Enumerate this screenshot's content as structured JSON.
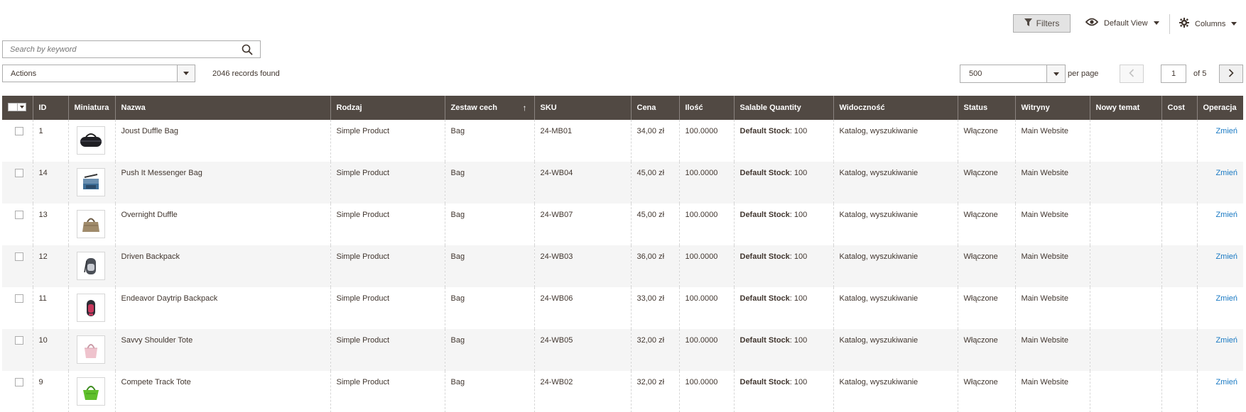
{
  "toolbar": {
    "filters_label": "Filters",
    "view_label": "Default View",
    "columns_label": "Columns"
  },
  "search": {
    "placeholder": "Search by keyword"
  },
  "actions": {
    "label": "Actions"
  },
  "records": {
    "label": "2046 records found"
  },
  "pager": {
    "per_page_value": "500",
    "per_page_label": "per page",
    "current_page": "1",
    "of_label": "of 5"
  },
  "table": {
    "headers": {
      "id": "ID",
      "thumb": "Miniatura",
      "name": "Nazwa",
      "type": "Rodzaj",
      "attrset": "Zestaw cech",
      "sku": "SKU",
      "price": "Cena",
      "qty": "Ilość",
      "salable": "Salable Quantity",
      "visibility": "Widoczność",
      "status": "Status",
      "websites": "Witryny",
      "newtheme": "Nowy temat",
      "cost": "Cost",
      "action": "Operacja"
    },
    "rows": [
      {
        "id": "1",
        "name": "Joust Duffle Bag",
        "type": "Simple Product",
        "attrset": "Bag",
        "sku": "24-MB01",
        "price": "34,00 zł",
        "qty": "100.0000",
        "stock_label": "Default Stock",
        "stock_value": ": 100",
        "visibility": "Katalog, wyszukiwanie",
        "status": "Włączone",
        "websites": "Main Website",
        "newtheme": "",
        "cost": "",
        "action": "Zmień",
        "thumb_icon": "duffle-bag-icon"
      },
      {
        "id": "14",
        "name": "Push It Messenger Bag",
        "type": "Simple Product",
        "attrset": "Bag",
        "sku": "24-WB04",
        "price": "45,00 zł",
        "qty": "100.0000",
        "stock_label": "Default Stock",
        "stock_value": ": 100",
        "visibility": "Katalog, wyszukiwanie",
        "status": "Włączone",
        "websites": "Main Website",
        "newtheme": "",
        "cost": "",
        "action": "Zmień",
        "thumb_icon": "messenger-bag-icon"
      },
      {
        "id": "13",
        "name": "Overnight Duffle",
        "type": "Simple Product",
        "attrset": "Bag",
        "sku": "24-WB07",
        "price": "45,00 zł",
        "qty": "100.0000",
        "stock_label": "Default Stock",
        "stock_value": ": 100",
        "visibility": "Katalog, wyszukiwanie",
        "status": "Włączone",
        "websites": "Main Website",
        "newtheme": "",
        "cost": "",
        "action": "Zmień",
        "thumb_icon": "overnight-duffle-icon"
      },
      {
        "id": "12",
        "name": "Driven Backpack",
        "type": "Simple Product",
        "attrset": "Bag",
        "sku": "24-WB03",
        "price": "36,00 zł",
        "qty": "100.0000",
        "stock_label": "Default Stock",
        "stock_value": ": 100",
        "visibility": "Katalog, wyszukiwanie",
        "status": "Włączone",
        "websites": "Main Website",
        "newtheme": "",
        "cost": "",
        "action": "Zmień",
        "thumb_icon": "backpack-icon"
      },
      {
        "id": "11",
        "name": "Endeavor Daytrip Backpack",
        "type": "Simple Product",
        "attrset": "Bag",
        "sku": "24-WB06",
        "price": "33,00 zł",
        "qty": "100.0000",
        "stock_label": "Default Stock",
        "stock_value": ": 100",
        "visibility": "Katalog, wyszukiwanie",
        "status": "Włączone",
        "websites": "Main Website",
        "newtheme": "",
        "cost": "",
        "action": "Zmień",
        "thumb_icon": "daytrip-backpack-icon"
      },
      {
        "id": "10",
        "name": "Savvy Shoulder Tote",
        "type": "Simple Product",
        "attrset": "Bag",
        "sku": "24-WB05",
        "price": "32,00 zł",
        "qty": "100.0000",
        "stock_label": "Default Stock",
        "stock_value": ": 100",
        "visibility": "Katalog, wyszukiwanie",
        "status": "Włączone",
        "websites": "Main Website",
        "newtheme": "",
        "cost": "",
        "action": "Zmień",
        "thumb_icon": "shoulder-tote-icon"
      },
      {
        "id": "9",
        "name": "Compete Track Tote",
        "type": "Simple Product",
        "attrset": "Bag",
        "sku": "24-WB02",
        "price": "32,00 zł",
        "qty": "100.0000",
        "stock_label": "Default Stock",
        "stock_value": ": 100",
        "visibility": "Katalog, wyszukiwanie",
        "status": "Włączone",
        "websites": "Main Website",
        "newtheme": "",
        "cost": "",
        "action": "Zmień",
        "thumb_icon": "track-tote-icon"
      }
    ]
  },
  "colors": {
    "header_bg": "#514943",
    "link": "#1979c3",
    "row_alt": "#f5f5f5"
  }
}
